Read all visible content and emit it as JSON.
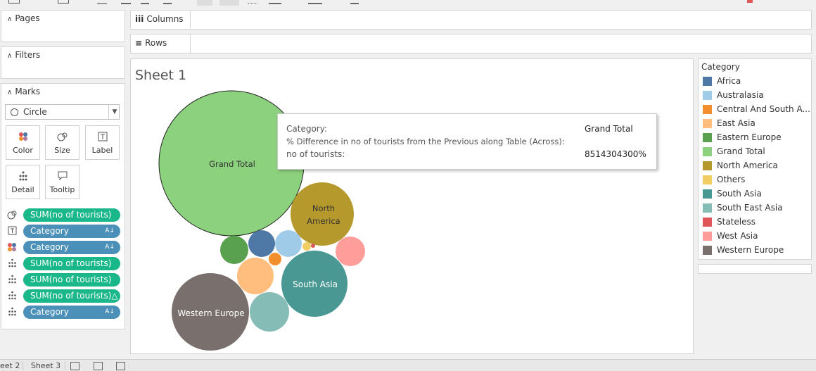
{
  "shelves": {
    "pages_title": "Pages",
    "filters_title": "Filters",
    "marks_title": "Marks",
    "columns_label": "Columns",
    "rows_label": "Rows"
  },
  "marks": {
    "mark_type": "Circle",
    "buttons": [
      {
        "label": "Color",
        "icon": "color-dots-icon"
      },
      {
        "label": "Size",
        "icon": "size-circles-icon"
      },
      {
        "label": "Label",
        "icon": "text-label-icon"
      },
      {
        "label": "Detail",
        "icon": "detail-dots-icon"
      },
      {
        "label": "Tooltip",
        "icon": "tooltip-bubble-icon"
      }
    ],
    "pills": [
      {
        "icon": "size-circles-icon",
        "label": "SUM(no of tourists)",
        "kind": "measure"
      },
      {
        "icon": "text-label-icon",
        "label": "Category",
        "kind": "dimension"
      },
      {
        "icon": "color-dots-icon",
        "label": "Category",
        "kind": "dimension"
      },
      {
        "icon": "detail-dots-icon",
        "label": "SUM(no of tourists)",
        "kind": "measure"
      },
      {
        "icon": "detail-dots-icon",
        "label": "SUM(no of tourists)",
        "kind": "measure"
      },
      {
        "icon": "detail-dots-icon",
        "label": "SUM(no of tourists)△",
        "kind": "measure"
      },
      {
        "icon": "detail-dots-icon",
        "label": "Category",
        "kind": "dimension"
      }
    ]
  },
  "sheet": {
    "title": "Sheet 1"
  },
  "bubbles": {
    "grand_total": "Grand Total",
    "north_america_1": "North",
    "north_america_2": "America",
    "south_asia": "South Asia",
    "western_europe": "Western Europe"
  },
  "tooltip": {
    "row1_label": "Category:",
    "row1_value": "Grand Total",
    "row2_label": "% Difference in no of tourists from the Previous along Table (Across):",
    "row3_label": "no of tourists:",
    "row3_value": "8514304300%"
  },
  "legend": {
    "title": "Category",
    "items": [
      {
        "label": "Africa",
        "color": "#4e79a7"
      },
      {
        "label": "Australasia",
        "color": "#a0cbe8"
      },
      {
        "label": "Central And South A...",
        "color": "#f28e2b"
      },
      {
        "label": "East Asia",
        "color": "#ffbe7d"
      },
      {
        "label": "Eastern Europe",
        "color": "#59a14f"
      },
      {
        "label": "Grand Total",
        "color": "#8cd17d"
      },
      {
        "label": "North America",
        "color": "#b6992d"
      },
      {
        "label": "Others",
        "color": "#f1ce63"
      },
      {
        "label": "South Asia",
        "color": "#499894"
      },
      {
        "label": "South East Asia",
        "color": "#86bcb6"
      },
      {
        "label": "Stateless",
        "color": "#e15759"
      },
      {
        "label": "West Asia",
        "color": "#ff9d9a"
      },
      {
        "label": "Western Europe",
        "color": "#79706e"
      }
    ]
  },
  "tabs": [
    {
      "label": "eet 2"
    },
    {
      "label": "Sheet 3"
    }
  ]
}
